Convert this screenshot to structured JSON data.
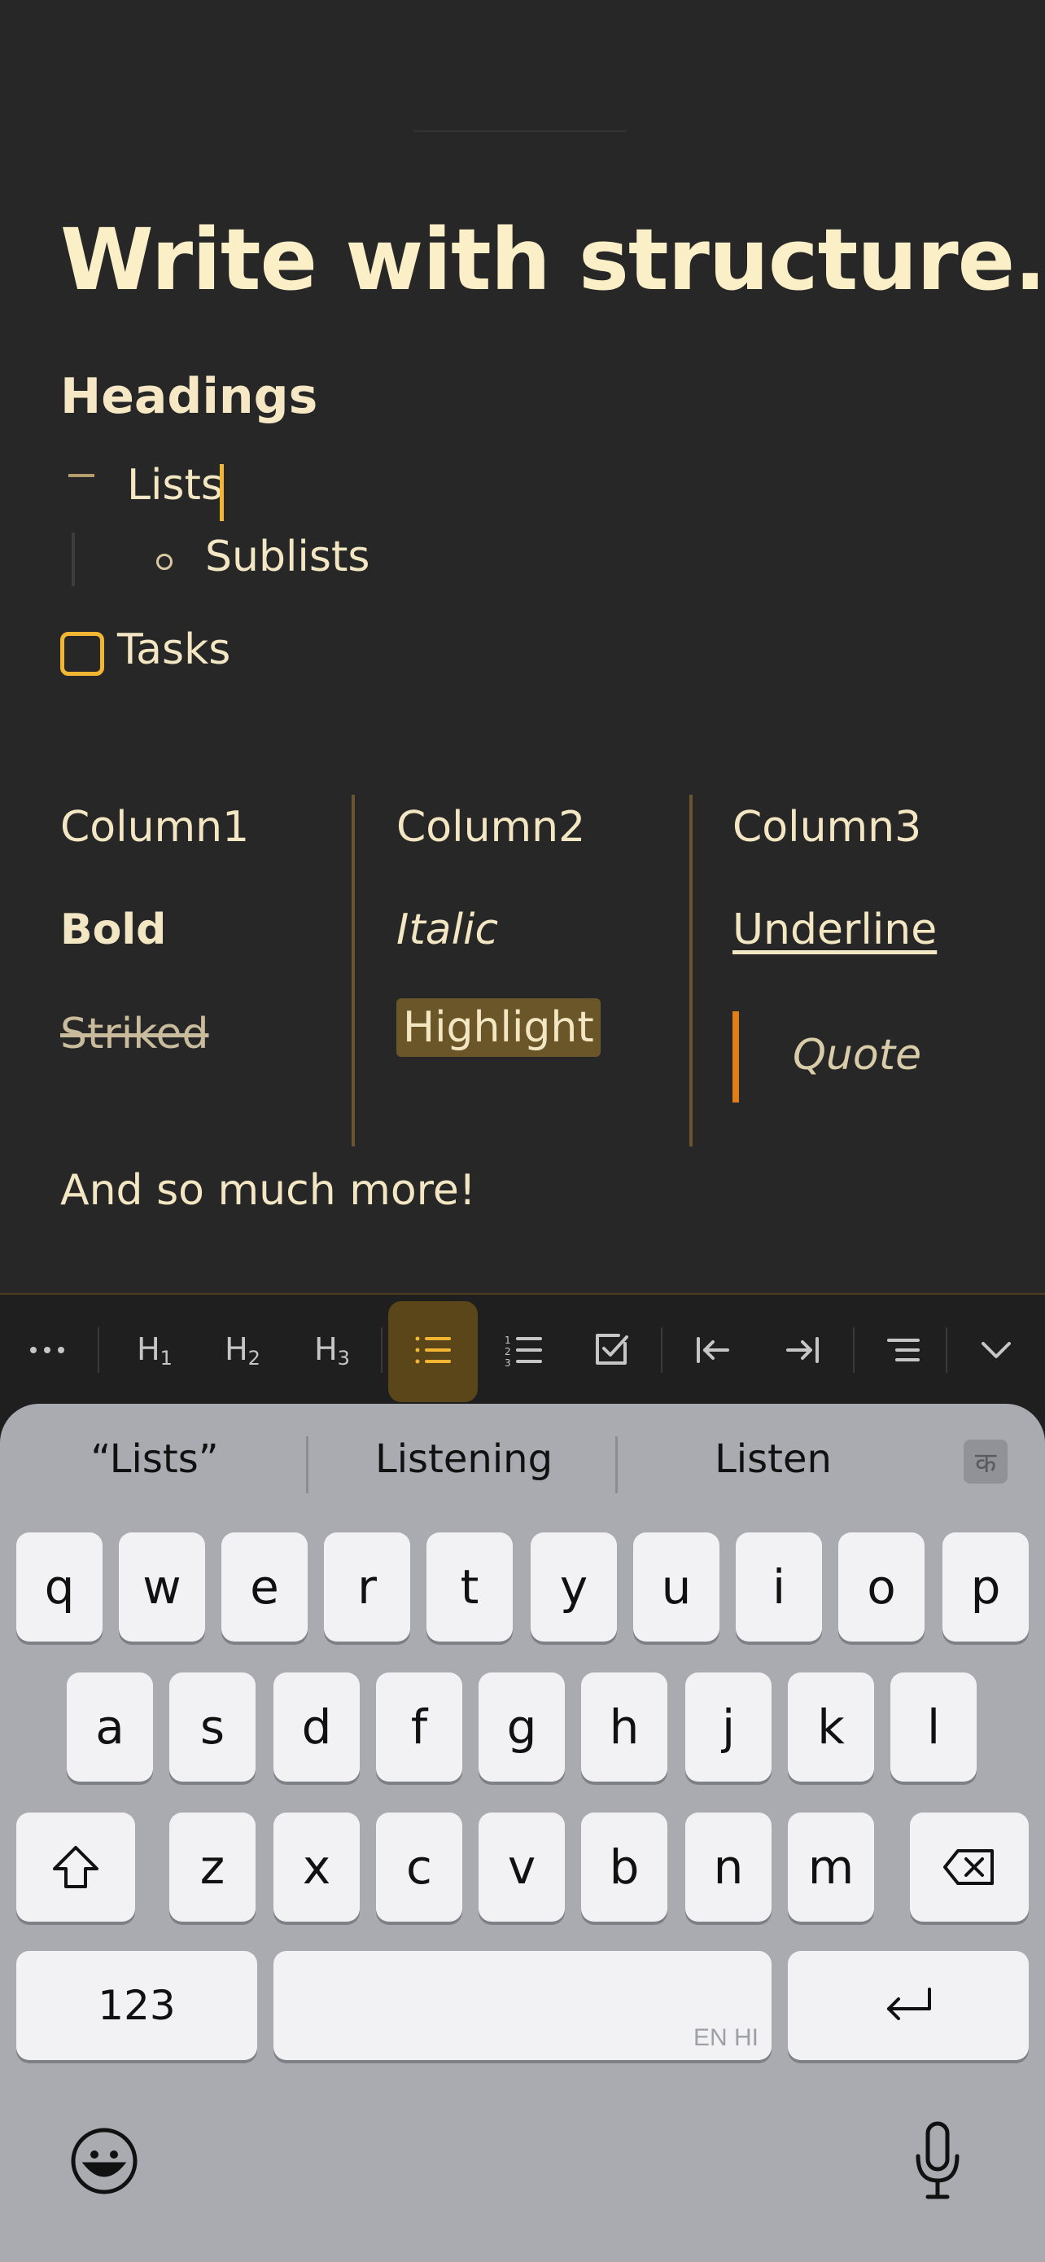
{
  "doc": {
    "title": "Write with structure.",
    "heading": "Headings",
    "list_item": "Lists",
    "sublist_item": "Sublists",
    "task_item": "Tasks",
    "columns": {
      "headers": [
        "Column1",
        "Column2",
        "Column3"
      ],
      "row1": [
        "Bold",
        "Italic",
        "Underline"
      ],
      "row2": [
        "Striked",
        "Highlight",
        "Quote"
      ]
    },
    "footer_text": "And so much more!"
  },
  "toolbar": {
    "items": [
      {
        "icon": "more-icon"
      },
      {
        "label": "H",
        "sub": "1"
      },
      {
        "label": "H",
        "sub": "2"
      },
      {
        "label": "H",
        "sub": "3"
      },
      {
        "icon": "bullet-list-icon",
        "active": true
      },
      {
        "icon": "numbered-list-icon"
      },
      {
        "icon": "checkbox-icon"
      },
      {
        "icon": "outdent-icon"
      },
      {
        "icon": "indent-icon"
      },
      {
        "icon": "text-format-icon"
      },
      {
        "icon": "chevron-down-icon"
      }
    ],
    "accent_color": "#f2b632"
  },
  "keyboard": {
    "suggestions": [
      "“Lists”",
      "Listening",
      "Listen"
    ],
    "language_key": "क",
    "rows": [
      [
        "q",
        "w",
        "e",
        "r",
        "t",
        "y",
        "u",
        "i",
        "o",
        "p"
      ],
      [
        "a",
        "s",
        "d",
        "f",
        "g",
        "h",
        "j",
        "k",
        "l"
      ],
      [
        "z",
        "x",
        "c",
        "v",
        "b",
        "n",
        "m"
      ]
    ],
    "numbers_key": "123",
    "space_lang": "EN HI"
  }
}
